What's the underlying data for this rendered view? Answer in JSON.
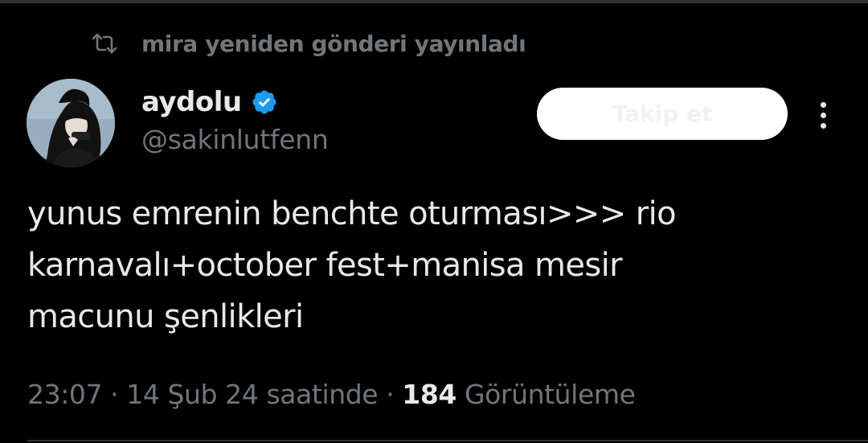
{
  "repost": {
    "text": "mira yeniden gönderi yayınladı",
    "icon": "repost-icon"
  },
  "author": {
    "display_name": "aydolu",
    "handle": "@sakinlutfenn",
    "verified_icon": "verified-badge-icon",
    "verified_color": "#1d9bf0"
  },
  "actions": {
    "follow_label": "Takip et",
    "more_icon": "more-options-icon"
  },
  "post": {
    "lines": [
      "yunus emrenin benchte oturması>>> rio",
      "karnavalı+october fest+manisa mesir",
      "macunu şenlikleri"
    ]
  },
  "meta": {
    "time": "23:07",
    "separator": "·",
    "date": "14 Şub 24 saatinde",
    "views_count": "184",
    "views_label": "Görüntüleme"
  },
  "colors": {
    "background": "#000000",
    "primary_text": "#e7e9ea",
    "secondary_text": "#71767b",
    "divider": "#2f3336"
  }
}
